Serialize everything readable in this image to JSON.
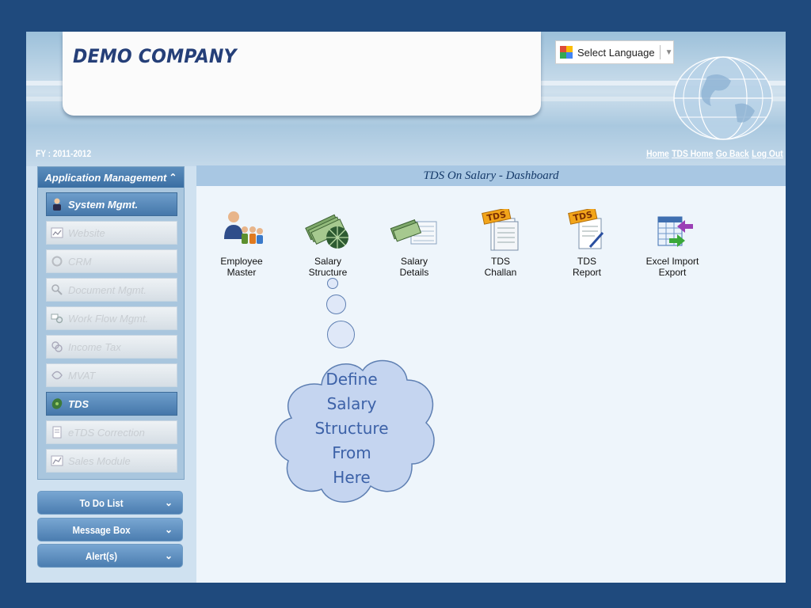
{
  "header": {
    "company": "DEMO COMPANY",
    "language_select": "Select Language",
    "fy": "FY : 2011-2012",
    "links": [
      "Home",
      "TDS Home",
      "Go Back",
      "Log Out"
    ]
  },
  "sidebar": {
    "heading": "Application Management",
    "items": [
      {
        "label": "System Mgmt.",
        "icon": "person-icon",
        "active": true
      },
      {
        "label": "Website",
        "icon": "website-icon",
        "active": false
      },
      {
        "label": "CRM",
        "icon": "crm-icon",
        "active": false
      },
      {
        "label": "Document Mgmt.",
        "icon": "document-search-icon",
        "active": false
      },
      {
        "label": "Work Flow Mgmt.",
        "icon": "workflow-icon",
        "active": false
      },
      {
        "label": "Income Tax",
        "icon": "income-tax-icon",
        "active": false
      },
      {
        "label": "MVAT",
        "icon": "mvat-icon",
        "active": false
      },
      {
        "label": "TDS",
        "icon": "tds-icon",
        "active": true
      },
      {
        "label": "eTDS Correction",
        "icon": "etds-icon",
        "active": false
      },
      {
        "label": "Sales Module",
        "icon": "sales-icon",
        "active": false
      }
    ],
    "panels": [
      "To Do List",
      "Message Box",
      "Alert(s)"
    ]
  },
  "main": {
    "title": "TDS On Salary - Dashboard",
    "tiles": [
      {
        "line1": "Employee",
        "line2": "Master",
        "icon": "employee-master-icon"
      },
      {
        "line1": "Salary",
        "line2": "Structure",
        "icon": "salary-structure-icon"
      },
      {
        "line1": "Salary",
        "line2": "Details",
        "icon": "salary-details-icon"
      },
      {
        "line1": "TDS",
        "line2": "Challan",
        "icon": "tds-challan-icon"
      },
      {
        "line1": "TDS",
        "line2": "Report",
        "icon": "tds-report-icon"
      },
      {
        "line1": "Excel Import",
        "line2": "Export",
        "icon": "excel-import-export-icon"
      }
    ]
  },
  "callout": {
    "lines": [
      "Define",
      "Salary",
      "Structure",
      "From",
      "Here"
    ]
  },
  "colors": {
    "background": "#1f4a7d",
    "brand_text": "#253f78",
    "active_item": "#4577aa",
    "callout_fill": "#c5d5f0",
    "callout_text": "#3d62a8"
  }
}
